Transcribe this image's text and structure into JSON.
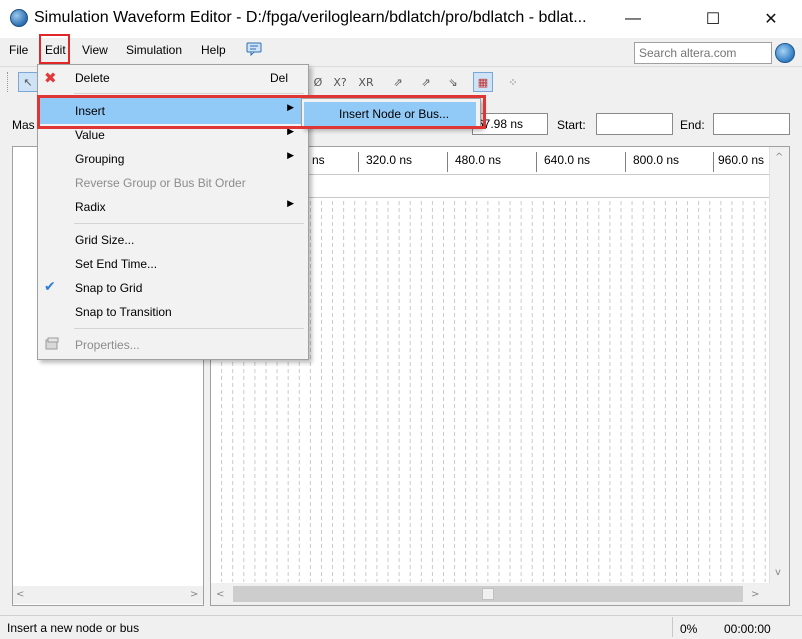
{
  "window": {
    "title": "Simulation Waveform Editor - D:/fpga/veriloglearn/bdlatch/pro/bdlatch - bdlat...",
    "minimize_glyph": "—",
    "maximize_glyph": "☐",
    "close_glyph": "✕"
  },
  "menubar": {
    "items": [
      {
        "label": "File",
        "underline": "F"
      },
      {
        "label": "Edit",
        "underline": "E"
      },
      {
        "label": "View",
        "underline": "V"
      },
      {
        "label": "Simulation",
        "underline": "S"
      },
      {
        "label": "Help",
        "underline": "H"
      }
    ],
    "search_placeholder": "Search altera.com"
  },
  "timebar": {
    "master_label": "Mas",
    "interval_value": "67.98 ns",
    "start_label": "Start:",
    "start_value": "",
    "end_label": "End:",
    "end_value": ""
  },
  "ruler": {
    "ticks": [
      "ns",
      "320.0 ns",
      "480.0 ns",
      "640.0 ns",
      "800.0 ns",
      "960.0 ns"
    ]
  },
  "edit_menu": {
    "items": [
      {
        "label": "Delete",
        "shortcut": "Del",
        "icon": "delete-x-icon",
        "enabled": true,
        "submenu": false
      },
      {
        "label": "Insert",
        "shortcut": "",
        "enabled": true,
        "submenu": true,
        "highlighted": true
      },
      {
        "label": "Value",
        "shortcut": "",
        "enabled": true,
        "submenu": true
      },
      {
        "label": "Grouping",
        "shortcut": "",
        "enabled": true,
        "submenu": true
      },
      {
        "label": "Reverse Group or Bus Bit Order",
        "shortcut": "",
        "enabled": false,
        "submenu": false
      },
      {
        "label": "Radix",
        "shortcut": "",
        "enabled": true,
        "submenu": true
      },
      {
        "label": "Grid Size...",
        "shortcut": "",
        "enabled": true,
        "submenu": false
      },
      {
        "label": "Set End Time...",
        "shortcut": "",
        "enabled": true,
        "submenu": false
      },
      {
        "label": "Snap to Grid",
        "shortcut": "",
        "enabled": true,
        "checked": true,
        "submenu": false
      },
      {
        "label": "Snap to Transition",
        "shortcut": "",
        "enabled": true,
        "submenu": false
      },
      {
        "label": "Properties...",
        "shortcut": "",
        "enabled": false,
        "icon": "properties-icon",
        "submenu": false
      }
    ],
    "submenu_arrow": "▶",
    "check_glyph": "✔",
    "delete_glyph": "✖"
  },
  "insert_submenu": {
    "items": [
      {
        "label": "Insert Node or Bus...",
        "highlighted": true
      }
    ]
  },
  "statusbar": {
    "message": "Insert a new node or bus",
    "progress": "0%",
    "time": "00:00:00"
  },
  "colors": {
    "highlight": "#91c9f7",
    "annotation_red": "#e03535",
    "check_blue": "#2b7fd6",
    "delete_red": "#e23a3a"
  }
}
